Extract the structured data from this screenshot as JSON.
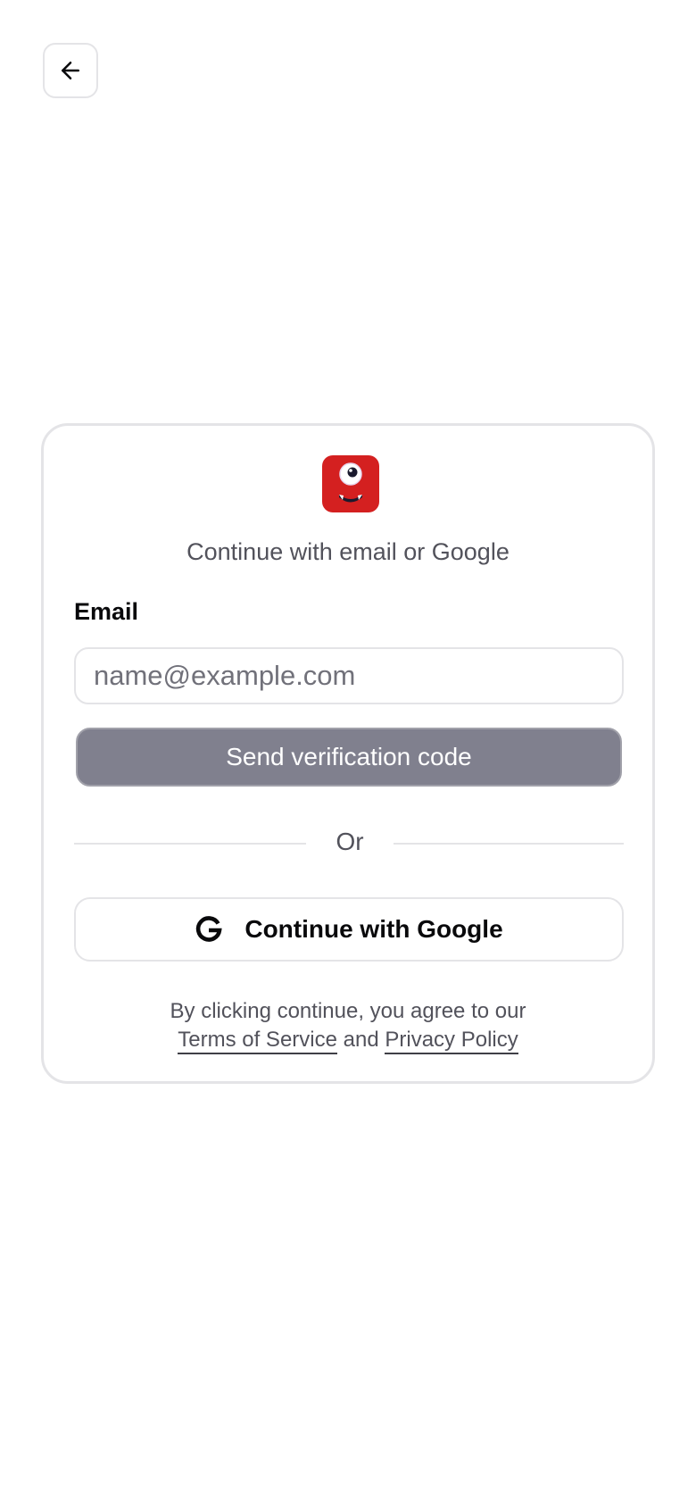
{
  "header": {
    "back_icon": "arrow-left-icon"
  },
  "auth_card": {
    "logo_icon": "red-one-eyed-monster-logo",
    "subtitle": "Continue with email or Google",
    "email_label": "Email",
    "email_value": "",
    "email_placeholder": "name@example.com",
    "send_button_label": "Send verification code",
    "divider_text": "Or",
    "google_icon": "google-g-icon",
    "google_button_label": "Continue with Google",
    "terms_prefix": "By clicking continue, you agree to our",
    "terms_link": "Terms of Service",
    "terms_and": "and",
    "privacy_link": "Privacy Policy"
  },
  "colors": {
    "accent_red": "#d42020",
    "disabled_button": "#80808e",
    "border": "#e4e4e7",
    "text_muted": "#52525b"
  }
}
